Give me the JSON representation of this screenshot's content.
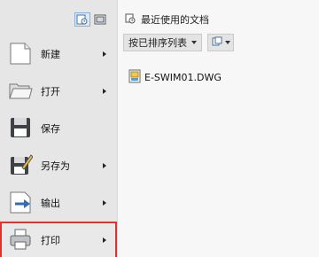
{
  "app_menu": {
    "items": [
      {
        "label": "新建",
        "icon": "new-file-icon",
        "has_submenu": true
      },
      {
        "label": "打开",
        "icon": "open-folder-icon",
        "has_submenu": true
      },
      {
        "label": "保存",
        "icon": "save-icon",
        "has_submenu": false
      },
      {
        "label": "另存为",
        "icon": "save-as-icon",
        "has_submenu": true
      },
      {
        "label": "输出",
        "icon": "export-icon",
        "has_submenu": true
      },
      {
        "label": "打印",
        "icon": "print-icon",
        "has_submenu": true,
        "highlighted": true
      }
    ],
    "view_buttons": [
      "recent-documents-view-icon",
      "open-documents-view-icon"
    ]
  },
  "recent": {
    "title": "最近使用的文档",
    "sort_dropdown": "按已排序列表",
    "files": [
      {
        "name": "E-SWIM01.DWG",
        "icon": "dwg-file-icon"
      }
    ]
  },
  "colors": {
    "highlight_border": "#e1322d",
    "accent_blue": "#2f6db5"
  }
}
